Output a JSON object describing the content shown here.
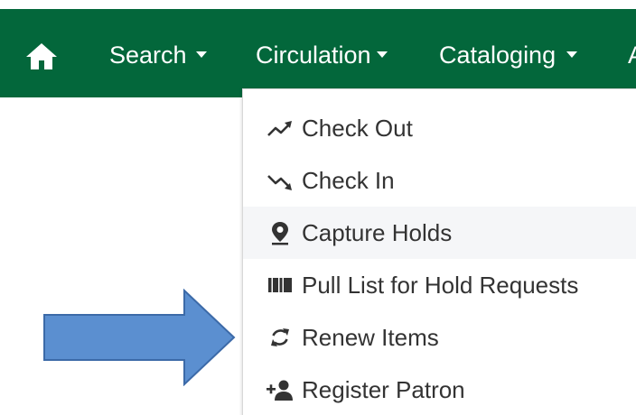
{
  "navbar": {
    "background": "#03673b",
    "home_icon": "home-icon",
    "items": [
      {
        "label": "Search"
      },
      {
        "label": "Circulation"
      },
      {
        "label": "Cataloging"
      }
    ]
  },
  "menu": {
    "items": [
      {
        "label": "Check Out",
        "icon": "trending-up-icon"
      },
      {
        "label": "Check In",
        "icon": "trending-down-icon"
      },
      {
        "label": "Capture Holds",
        "icon": "map-pin-icon"
      },
      {
        "label": "Pull List for Hold Requests",
        "icon": "barcode-icon"
      },
      {
        "label": "Renew Items",
        "icon": "refresh-icon"
      },
      {
        "label": "Register Patron",
        "icon": "add-user-icon"
      }
    ]
  },
  "annotation": {
    "arrow_color": "#5b8fd0",
    "arrow_icon": "right-arrow-icon"
  }
}
